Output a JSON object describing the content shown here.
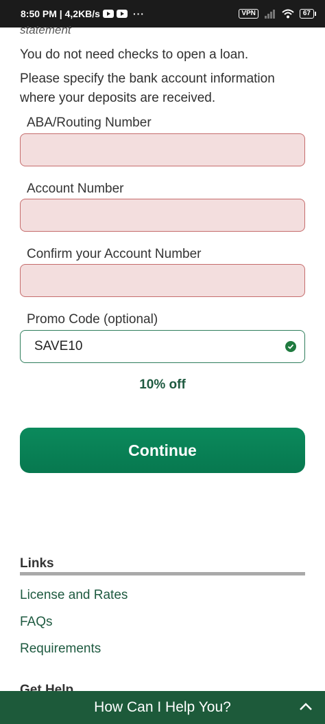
{
  "status_bar": {
    "time_info": "8:50 PM | 4,2KB/s",
    "dots": "···",
    "vpn": "VPN",
    "battery": "67"
  },
  "form": {
    "cut_text": "statement",
    "no_checks_text": "You do not need checks to open a loan.",
    "specify_text": "Please specify the bank account information where your deposits are received.",
    "routing_label": "ABA/Routing Number",
    "routing_value": "",
    "account_label": "Account Number",
    "account_value": "",
    "confirm_label": "Confirm your Account Number",
    "confirm_value": "",
    "promo_label": "Promo Code (optional)",
    "promo_value": "SAVE10",
    "promo_message": "10% off",
    "continue_label": "Continue"
  },
  "links": {
    "heading": "Links",
    "items": [
      "License and Rates",
      "FAQs",
      "Requirements"
    ]
  },
  "footer": {
    "get_help_peek": "Get Help",
    "help_bar_label": "How Can I Help You?"
  },
  "colors": {
    "accent": "#0b8a5c",
    "link": "#1e5a40",
    "error_fill": "#f3dede",
    "help_bar": "#1d5a3a"
  }
}
